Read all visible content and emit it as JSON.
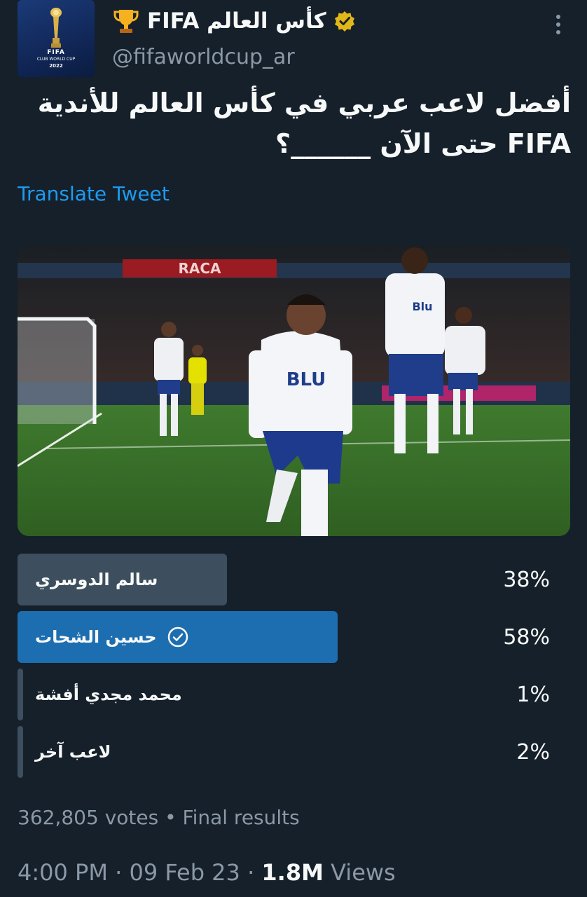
{
  "account": {
    "display_name": "كأس العالم FIFA",
    "handle": "@fifaworldcup_ar",
    "avatar_logo": {
      "line1": "FIFA",
      "line2": "CLUB WORLD CUP",
      "line3": "2022"
    },
    "badge": "verified-icon",
    "emoji": "trophy-icon"
  },
  "tweet": {
    "text": "أفضل لاعب عربي في كأس العالم للأندية FIFA حتى الآن ______؟",
    "translate_label": "Translate Tweet"
  },
  "media": {
    "banner_text": "RACA"
  },
  "poll": {
    "options": [
      {
        "label": "سالم الدوسري",
        "percent": "38%",
        "value": 38,
        "selected": false
      },
      {
        "label": "حسين الشحات",
        "percent": "58%",
        "value": 58,
        "selected": true
      },
      {
        "label": "محمد مجدي أفشة",
        "percent": "1%",
        "value": 1,
        "selected": false
      },
      {
        "label": "لاعب آخر",
        "percent": "2%",
        "value": 2,
        "selected": false
      }
    ],
    "summary": "362,805 votes • Final results"
  },
  "meta": {
    "time": "4:00 PM · 09 Feb 23 · ",
    "views_count": "1.8M",
    "views_label": " Views"
  },
  "colors": {
    "background": "#15202b",
    "link": "#1d9bf0",
    "winner_bar": "#1d6eb0",
    "other_bar": "#3d4e5e",
    "muted_text": "#8b98a5"
  }
}
